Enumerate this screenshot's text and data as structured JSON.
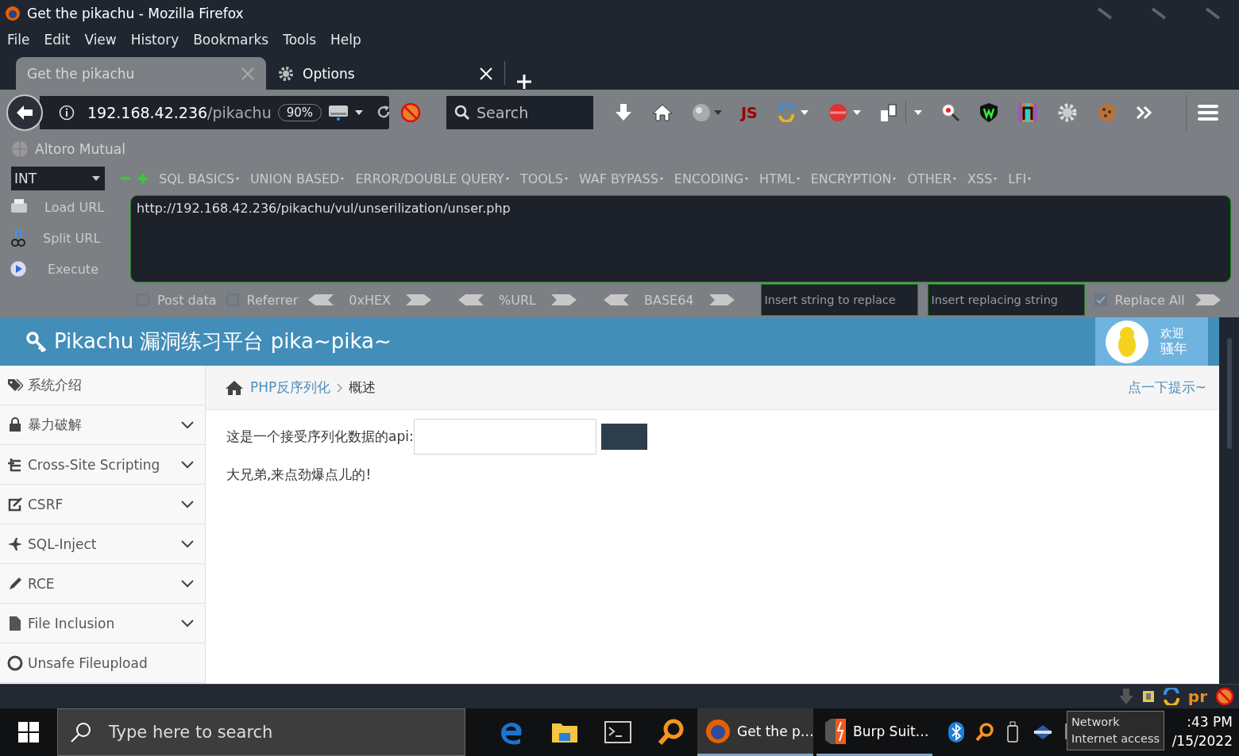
{
  "window": {
    "title": "Get the pikachu - Mozilla Firefox"
  },
  "menu": [
    "File",
    "Edit",
    "View",
    "History",
    "Bookmarks",
    "Tools",
    "Help"
  ],
  "tabs": [
    {
      "label": "Get the pikachu",
      "selected": true
    },
    {
      "label": "Options",
      "selected": false
    }
  ],
  "nav": {
    "url_host": "192.168.42.236",
    "url_path": "/pikachu",
    "zoom": "90%",
    "search_placeholder": "Search",
    "js_label": "JS"
  },
  "bookmarks": [
    "Altoro Mutual"
  ],
  "hackbar": {
    "select": "INT",
    "menus": [
      "SQL BASICS",
      "UNION BASED",
      "ERROR/DOUBLE QUERY",
      "TOOLS",
      "WAF BYPASS",
      "ENCODING",
      "HTML",
      "ENCRYPTION",
      "OTHER",
      "XSS",
      "LFI"
    ],
    "actions": [
      "Load URL",
      "Split URL",
      "Execute"
    ],
    "url": "http://192.168.42.236/pikachu/vul/unserilization/unser.php",
    "options": [
      {
        "kind": "checkbox",
        "label": "Post data",
        "checked": false
      },
      {
        "kind": "checkbox",
        "label": "Referrer",
        "checked": false
      },
      {
        "kind": "encoder",
        "label": "0xHEX"
      },
      {
        "kind": "encoder",
        "label": "%URL"
      },
      {
        "kind": "encoder",
        "label": "BASE64"
      },
      {
        "kind": "field",
        "placeholder": "Insert string to replace"
      },
      {
        "kind": "field",
        "placeholder": "Insert replacing string"
      },
      {
        "kind": "checkbox",
        "label": "Replace All",
        "checked": true
      }
    ]
  },
  "site": {
    "title": "Pikachu 漏洞练习平台 pika~pika~",
    "greeting": [
      "欢迎",
      "骚年"
    ]
  },
  "sidebar": [
    {
      "label": "系统介绍",
      "expandable": false
    },
    {
      "label": "暴力破解",
      "expandable": true
    },
    {
      "label": "Cross-Site Scripting",
      "expandable": true
    },
    {
      "label": "CSRF",
      "expandable": true
    },
    {
      "label": "SQL-Inject",
      "expandable": true
    },
    {
      "label": "RCE",
      "expandable": true
    },
    {
      "label": "File Inclusion",
      "expandable": true
    },
    {
      "label": "Unsafe Fileupload",
      "expandable": false
    }
  ],
  "breadcrumb": {
    "parent": "PHP反序列化",
    "current": "概述",
    "hint": "点一下提示~"
  },
  "form": {
    "label": "这是一个接受序列化数据的api:"
  },
  "message": "大兄弟,来点劲爆点儿的!",
  "tray_label": "pr",
  "taskbar": {
    "search_placeholder": "Type here to search",
    "windows": [
      {
        "label": "Get the p…",
        "selected": true
      },
      {
        "label": "Burp Suit…",
        "selected": false
      }
    ],
    "tooltip": [
      "Network",
      "Internet access"
    ],
    "clock": [
      ":43 PM",
      "/15/2022"
    ]
  }
}
